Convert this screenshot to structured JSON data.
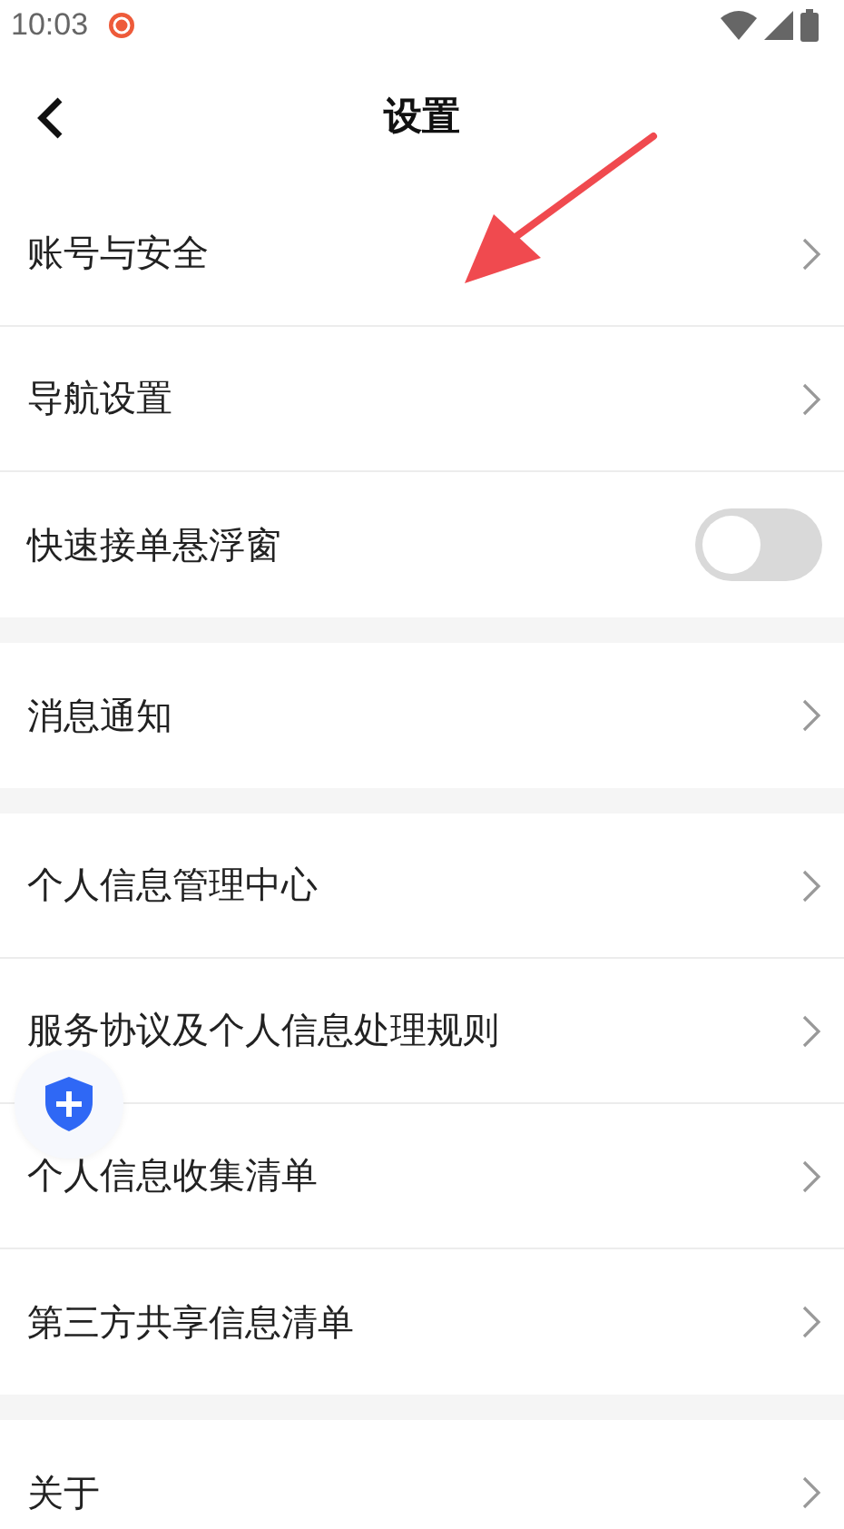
{
  "status_bar": {
    "time": "10:03"
  },
  "header": {
    "title": "设置"
  },
  "sections": [
    {
      "items": [
        {
          "kind": "link",
          "label": "账号与安全"
        },
        {
          "kind": "link",
          "label": "导航设置"
        },
        {
          "kind": "toggle",
          "label": "快速接单悬浮窗",
          "on": false
        }
      ]
    },
    {
      "items": [
        {
          "kind": "link",
          "label": "消息通知"
        }
      ]
    },
    {
      "items": [
        {
          "kind": "link",
          "label": "个人信息管理中心"
        },
        {
          "kind": "link",
          "label": "服务协议及个人信息处理规则"
        },
        {
          "kind": "link",
          "label": "个人信息收集清单"
        },
        {
          "kind": "link",
          "label": "第三方共享信息清单"
        }
      ]
    },
    {
      "items": [
        {
          "kind": "link",
          "label": "关于"
        }
      ]
    }
  ]
}
